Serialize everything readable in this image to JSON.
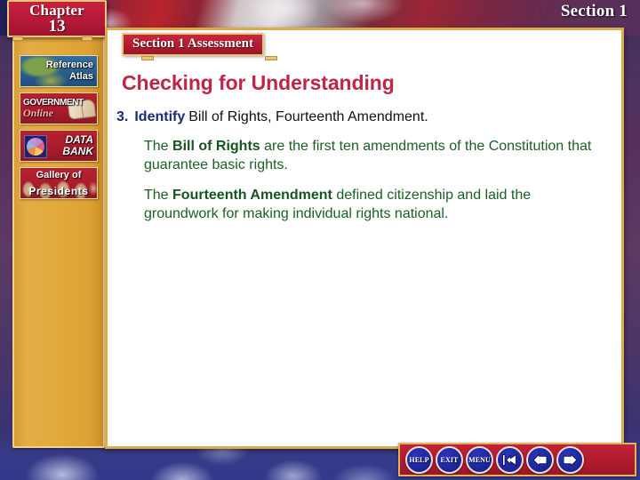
{
  "chapter": {
    "word": "Chapter",
    "number": "13"
  },
  "header": {
    "section_label": "Section 1"
  },
  "sidebar": {
    "items": [
      {
        "id": "reference-atlas",
        "line1": "Reference",
        "line2": "Atlas"
      },
      {
        "id": "government-online",
        "line1": "GOVERNMENT",
        "line2": "Online"
      },
      {
        "id": "data-bank",
        "line1": "DATA",
        "line2": "BANK"
      },
      {
        "id": "gallery-of-presidents",
        "line1": "Gallery of",
        "line2": "Presidents"
      }
    ]
  },
  "content": {
    "assessment_tab": "Section 1 Assessment",
    "page_title": "Checking for Understanding",
    "question": {
      "number": "3.",
      "verb": "Identify",
      "prompt": "Bill of Rights, Fourteenth Amendment."
    },
    "answers": [
      {
        "lead": "The ",
        "term": "Bill of Rights",
        "rest": " are the first ten amendments of the Constitution that guarantee basic rights."
      },
      {
        "lead": "The ",
        "term": "Fourteenth Amendment",
        "rest": " defined citizenship and laid the groundwork for making individual rights national."
      }
    ]
  },
  "navbar": {
    "buttons": [
      {
        "id": "help-button",
        "label": "HELP",
        "kind": "text"
      },
      {
        "id": "exit-button",
        "label": "EXIT",
        "kind": "text"
      },
      {
        "id": "menu-button",
        "label": "MENU",
        "kind": "text"
      },
      {
        "id": "first-page-button",
        "label": "",
        "kind": "first"
      },
      {
        "id": "previous-page-button",
        "label": "",
        "kind": "back"
      },
      {
        "id": "next-page-button",
        "label": "",
        "kind": "forward"
      }
    ]
  },
  "colors": {
    "gold": "#e2a93c",
    "red": "#b41c33",
    "navy": "#1b2a77",
    "crimson": "#bf2548",
    "green": "#1a6024",
    "button_blue": "#1f2aa6"
  }
}
